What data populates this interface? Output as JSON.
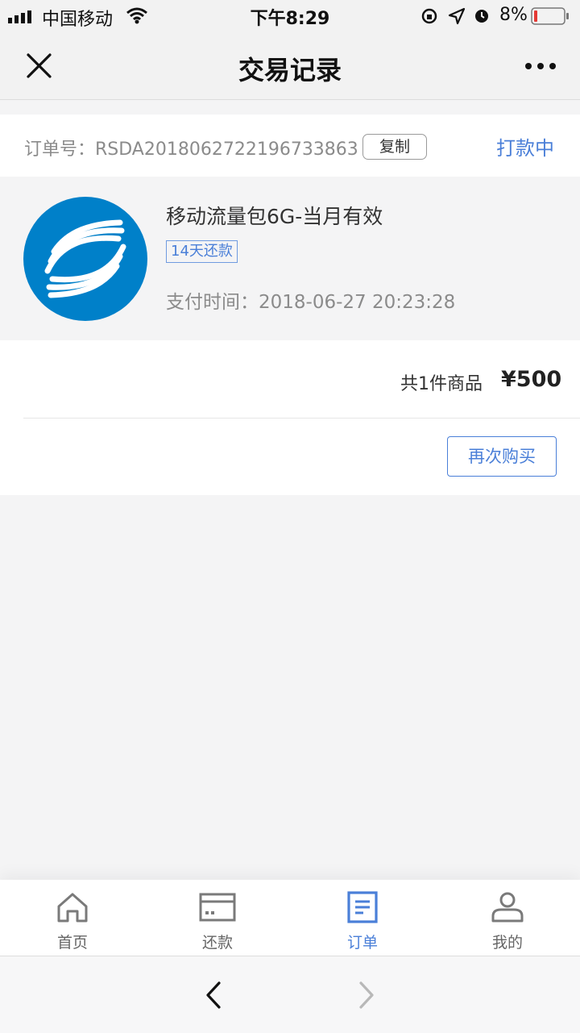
{
  "status_bar": {
    "carrier": "中国移动",
    "time": "下午8:29",
    "battery": "8%"
  },
  "nav": {
    "title": "交易记录"
  },
  "order": {
    "number_label": "订单号：RSDA2018062722196733863",
    "copy_label": "复制",
    "status": "打款中",
    "product_name": "移动流量包6G-当月有效",
    "tag": "14天还款",
    "pay_time": "支付时间：2018-06-27 20:23:28",
    "count_label": "共1件商品",
    "total": "¥500",
    "rebuy_label": "再次购买"
  },
  "tabs": [
    {
      "label": "首页",
      "icon": "home-icon",
      "active": false
    },
    {
      "label": "还款",
      "icon": "card-icon",
      "active": false
    },
    {
      "label": "订单",
      "icon": "document-icon",
      "active": true
    },
    {
      "label": "我的",
      "icon": "user-icon",
      "active": false
    }
  ],
  "colors": {
    "accent": "#4a7fd8",
    "brand_logo": "#0080c9",
    "battery_low": "#e53935"
  }
}
